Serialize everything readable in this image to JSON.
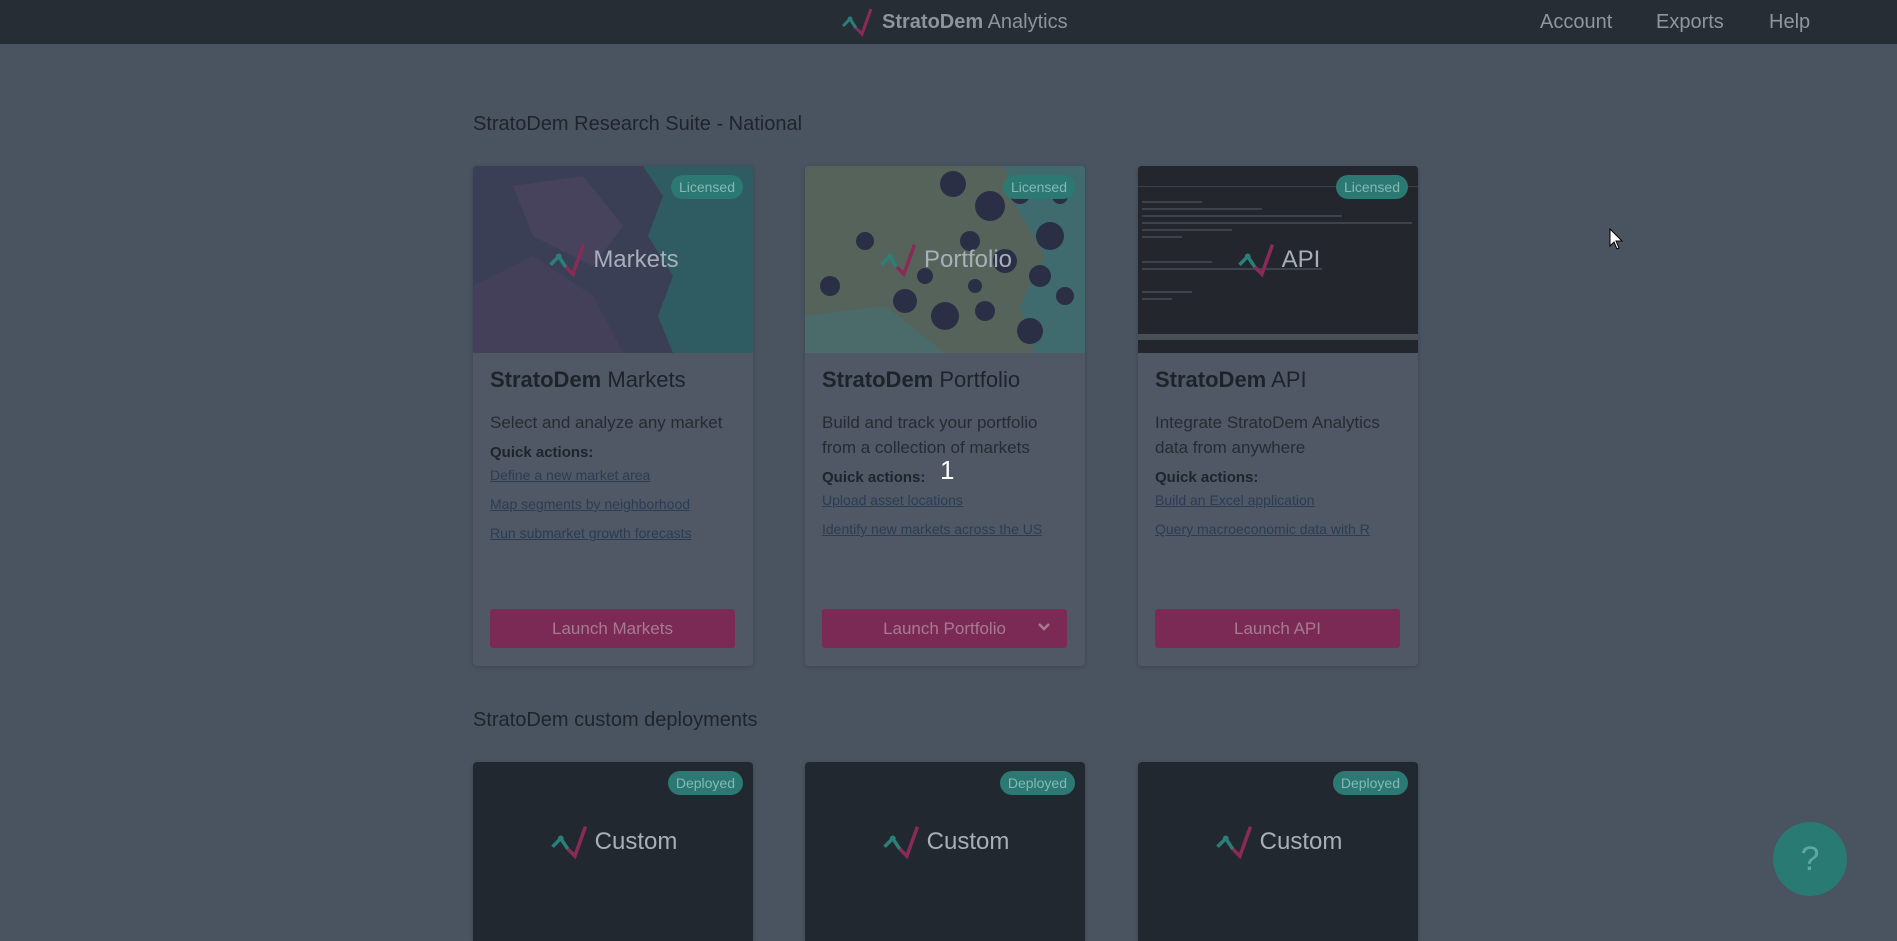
{
  "header": {
    "brand_bold": "StratoDem",
    "brand_light": " Analytics",
    "nav": {
      "account": "Account",
      "exports": "Exports",
      "help": "Help"
    }
  },
  "sections": {
    "suite_title": "StratoDem Research Suite - National",
    "custom_title": "StratoDem custom deployments"
  },
  "cards": [
    {
      "image_label": "Markets",
      "badge": "Licensed",
      "title_bold": "StratoDem",
      "title_rest": " Markets",
      "description": "Select and analyze any market",
      "quick_actions_label": "Quick actions:",
      "links": [
        "Define a new market area",
        "Map segments by neighborhood",
        "Run submarket growth forecasts"
      ],
      "button": "Launch Markets"
    },
    {
      "image_label": "Portfolio",
      "badge": "Licensed",
      "title_bold": "StratoDem",
      "title_rest": " Portfolio",
      "description": "Build and track your portfolio from a collection of markets",
      "quick_actions_label": "Quick actions:",
      "links": [
        "Upload asset locations",
        "Identify new markets across the US"
      ],
      "button": "Launch Portfolio"
    },
    {
      "image_label": "API",
      "badge": "Licensed",
      "title_bold": "StratoDem",
      "title_rest": " API",
      "description": "Integrate StratoDem Analytics data from anywhere",
      "quick_actions_label": "Quick actions:",
      "links": [
        "Build an Excel application",
        "Query macroeconomic data with R"
      ],
      "button": "Launch API"
    }
  ],
  "custom_cards": [
    {
      "image_label": "Custom",
      "badge": "Deployed"
    },
    {
      "image_label": "Custom",
      "badge": "Deployed"
    },
    {
      "image_label": "Custom",
      "badge": "Deployed"
    }
  ],
  "overlay": {
    "step_number": "1"
  },
  "help_bubble": {
    "icon": "question-mark-icon",
    "glyph": "?"
  },
  "colors": {
    "accent_button": "#7b2a55",
    "badge": "#2c7873",
    "logo_teal": "#2f9e93",
    "logo_pink": "#c2185b"
  }
}
